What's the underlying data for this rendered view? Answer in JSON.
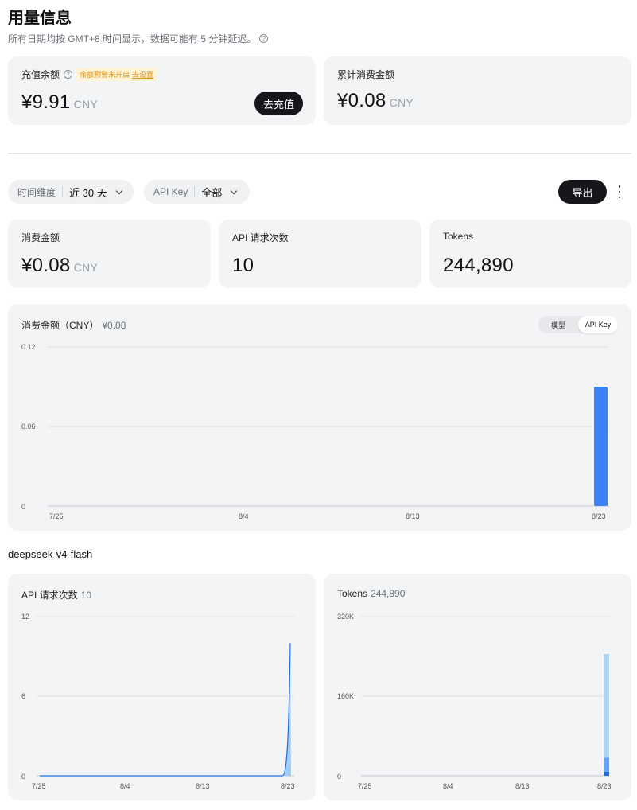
{
  "header": {
    "title": "用量信息",
    "subtitle": "所有日期均按 GMT+8 时间显示，数据可能有 5 分钟延迟。"
  },
  "balance": {
    "label": "充值余额",
    "warning": "余额预警未开启",
    "warning_link": "去设置",
    "amount": "¥9.91",
    "currency": "CNY",
    "recharge_button": "去充值"
  },
  "cumulative": {
    "label": "累计消费金额",
    "amount": "¥0.08",
    "currency": "CNY"
  },
  "filters": {
    "time_label": "时间维度",
    "time_value": "近 30 天",
    "key_label": "API Key",
    "key_value": "全部",
    "export_button": "导出"
  },
  "stats": {
    "spend_label": "消费金额",
    "spend_amount": "¥0.08",
    "spend_currency": "CNY",
    "requests_label": "API 请求次数",
    "requests_value": "10",
    "tokens_label": "Tokens",
    "tokens_value": "244,890"
  },
  "spend_chart": {
    "title": "消费金额（CNY）",
    "total": "¥0.08",
    "toggle": [
      "模型",
      "API Key"
    ],
    "toggle_active": "API Key"
  },
  "model_section": {
    "title": "deepseek-v4-flash",
    "requests_title": "API 请求次数",
    "requests_total": "10",
    "tokens_title": "Tokens",
    "tokens_total": "244,890"
  },
  "colors": {
    "bar_blue": "#3b82f6",
    "area_light": "#93c5fd",
    "token_light": "#a5d8fb",
    "token_mid": "#60a5fa",
    "token_dark": "#1d6fe0"
  },
  "chart_data": [
    {
      "type": "bar",
      "title": "消费金额（CNY） ¥0.08",
      "x_ticks": [
        "7/25",
        "8/4",
        "8/13",
        "8/23"
      ],
      "y_ticks": [
        "0.12",
        "0.06",
        "0"
      ],
      "ylim": [
        0,
        0.12
      ],
      "grid": true,
      "series": [
        {
          "x": "8/23",
          "values": [
            0.09
          ]
        }
      ]
    },
    {
      "type": "area",
      "title": "API 请求次数 10",
      "x_ticks": [
        "7/25",
        "8/4",
        "8/13",
        "8/23"
      ],
      "y_ticks": [
        "12",
        "6",
        "0"
      ],
      "ylim": [
        0,
        12
      ],
      "grid": true,
      "series": [
        {
          "x": [
            "7/25",
            "8/22",
            "8/23"
          ],
          "values": [
            0,
            0,
            10
          ]
        }
      ]
    },
    {
      "type": "bar",
      "title": "Tokens 244,890",
      "x_ticks": [
        "7/25",
        "8/4",
        "8/13",
        "8/23"
      ],
      "y_ticks": [
        "320K",
        "160K",
        "0"
      ],
      "ylim": [
        0,
        320000
      ],
      "grid": true,
      "stacked": true,
      "series": [
        {
          "x": "8/23",
          "values": [
            8000,
            28000,
            208890
          ]
        }
      ]
    }
  ]
}
